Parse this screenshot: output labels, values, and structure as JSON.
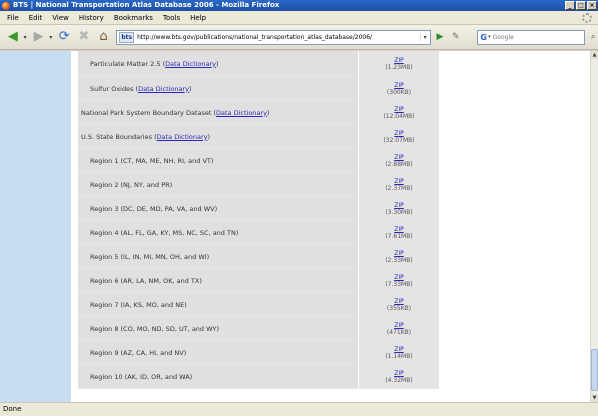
{
  "window": {
    "title": "BTS | National Transportation Atlas Database 2006 - Mozilla Firefox"
  },
  "menu": [
    "File",
    "Edit",
    "View",
    "History",
    "Bookmarks",
    "Tools",
    "Help"
  ],
  "address": {
    "site_badge": "bts",
    "url": "http://www.bts.gov/publications/national_transportation_atlas_database/2006/"
  },
  "search": {
    "placeholder": "Google"
  },
  "rows": [
    {
      "text": "Particulate Matter 2.5 (",
      "link": "Data Dictionary",
      "after": ")",
      "zip": "ZIP",
      "size": "(1.23MB)",
      "indent": 1,
      "height": 26
    },
    {
      "text": "Sulfur Oxides (",
      "link": "Data Dictionary",
      "after": ")",
      "zip": "ZIP",
      "size": "(300KB)",
      "indent": 1,
      "height": 24
    },
    {
      "text": "National Park System Boundary Dataset (",
      "link": "Data Dictionary",
      "after": ")",
      "zip": "ZIP",
      "size": "(12.04MB)",
      "indent": 0,
      "height": 24
    },
    {
      "text": "U.S. State Boundaries (",
      "link": "Data Dictionary",
      "after": ")",
      "zip": "ZIP",
      "size": "(32.07MB)",
      "indent": 0,
      "height": 24
    },
    {
      "text": "Region 1 (CT, MA, ME, NH, RI, and VT)",
      "zip": "ZIP",
      "size": "(2.88MB)",
      "indent": 1,
      "height": 24
    },
    {
      "text": "Region 2 (NJ, NY, and PR)",
      "zip": "ZIP",
      "size": "(2.37MB)",
      "indent": 1,
      "height": 24
    },
    {
      "text": "Region 3 (DC, DE, MD, PA, VA, and WV)",
      "zip": "ZIP",
      "size": "(3.30MB)",
      "indent": 1,
      "height": 24
    },
    {
      "text": "Region 4 (AL, FL, GA, KY, MS, NC, SC, and TN)",
      "zip": "ZIP",
      "size": "(7.61MB)",
      "indent": 1,
      "height": 24
    },
    {
      "text": "Region 5 (IL, IN, MI, MN, OH, and WI)",
      "zip": "ZIP",
      "size": "(2.33MB)",
      "indent": 1,
      "height": 24
    },
    {
      "text": "Region 6 (AR, LA, NM, OK, and TX)",
      "zip": "ZIP",
      "size": "(7.33MB)",
      "indent": 1,
      "height": 24
    },
    {
      "text": "Region 7 (IA, KS, MO, and NE)",
      "zip": "ZIP",
      "size": "(355KB)",
      "indent": 1,
      "height": 24
    },
    {
      "text": "Region 8 (CO, MO, ND, SD, UT, and WY)",
      "zip": "ZIP",
      "size": "(471KB)",
      "indent": 1,
      "height": 24
    },
    {
      "text": "Region 9 (AZ, CA, HI, and NV)",
      "zip": "ZIP",
      "size": "(1.14MB)",
      "indent": 1,
      "height": 24
    },
    {
      "text": "Region 10 (AK, ID, OR, and WA)",
      "zip": "ZIP",
      "size": "(4.32MB)",
      "indent": 1,
      "height": 24
    }
  ],
  "status": {
    "text": "Done"
  }
}
